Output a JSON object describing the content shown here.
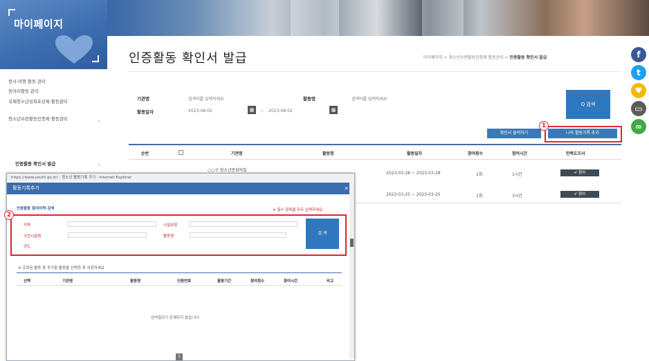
{
  "header": {
    "logo_title": "마이페이지"
  },
  "sidebar": {
    "items": [
      {
        "label": "봉사·여행 활동 관리"
      },
      {
        "label": "동아리활동 관리"
      },
      {
        "label": "국제청소년성취포상제 활동관리"
      },
      {
        "label": "청소년수련활동인증제 활동관리"
      },
      {
        "label": "인증활동 확인서 발급"
      }
    ]
  },
  "page": {
    "title": "인증활동 확인서 발급",
    "breadcrumb": "마이페이지 > 청소년수련활동인증제 활동관리 > ",
    "breadcrumb_current": "인증활동 확인서 발급"
  },
  "search_form": {
    "label_org": "기관명",
    "value_org": "검색어를 입력하세요",
    "label_activity": "활동명",
    "value_activity": "검색어를 입력하세요",
    "label_period": "활동일자",
    "date_from": "2023-08-02",
    "date_to": "2023-08-02",
    "date_sep": "~",
    "search_label": "Q 검색"
  },
  "actions": {
    "btn_print": "확인서 출력하기",
    "btn_add": "나의 활동기록 추가",
    "badge_1": "1",
    "badge_2": "2"
  },
  "table": {
    "headers": [
      "순번",
      "",
      "기관명",
      "활동명",
      "활동일자",
      "참여횟수",
      "참여시간",
      "만족도조사"
    ],
    "rows": [
      {
        "cells": [
          "",
          "",
          "○○구 청소년문화의집",
          "",
          "2023-03-28 ~ 2023-03-28",
          "1회",
          "1시간",
          "✔ 참여"
        ]
      },
      {
        "cells": [
          "",
          "",
          "",
          "",
          "2023-03-25 ~ 2023-03-25",
          "1회",
          "3시간",
          "✔ 참여"
        ]
      }
    ]
  },
  "popup": {
    "url_bar": "https://www.youth.go.kr/ - 청소년 활동기록 추가 - Internet Explorer",
    "title": "활동기록추가",
    "section1": "인증활동 참여이력 검색",
    "section1_note": "※ 필수 항목을 모두 입력하세요",
    "label_area": "지역",
    "label_org_type": "시설유형",
    "label_org_name": "수련시설명",
    "label_activity": "활동명",
    "label_year": "연도",
    "search_label": "검 색",
    "section2": "※ 조회된 활동 중 추가할 활동을 선택한 후 저장하세요",
    "headers": [
      "선택",
      "기관명",
      "활동명",
      "인증번호",
      "활동기간",
      "참여횟수",
      "참여시간",
      "비고"
    ],
    "empty_text": "검색결과가 존재하지 않습니다.",
    "page_number": "1"
  },
  "social": [
    {
      "name": "facebook-icon",
      "glyph": "f",
      "color": "#3b5998"
    },
    {
      "name": "twitter-icon",
      "glyph": "t",
      "color": "#1da1f2"
    },
    {
      "name": "kakaostory-icon",
      "glyph": "♥",
      "color": "#f5b800"
    },
    {
      "name": "band-icon",
      "glyph": "▭",
      "color": "#5b5b5b"
    },
    {
      "name": "link-icon",
      "glyph": "∞",
      "color": "#45a845"
    }
  ],
  "colors": {
    "accent": "#2f78bf",
    "highlight": "#d8262e",
    "header_blue": "#3a6cae"
  }
}
